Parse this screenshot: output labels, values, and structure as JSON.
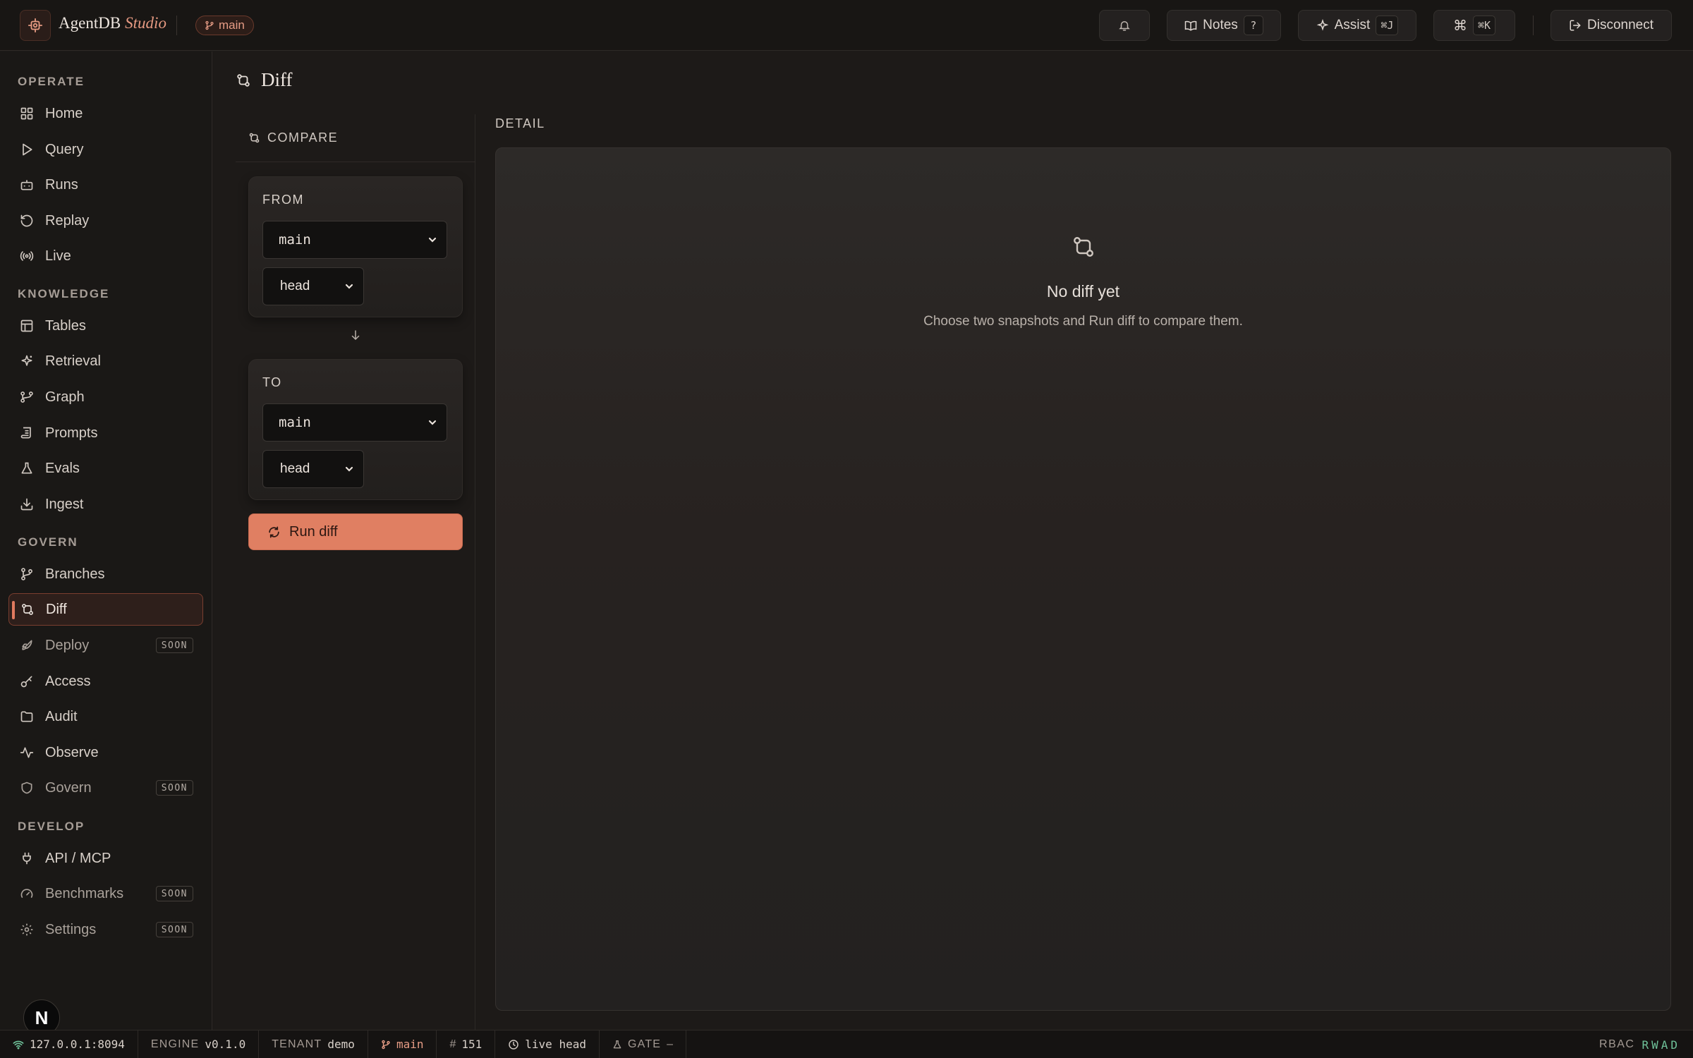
{
  "app": {
    "brand": "AgentDB",
    "brand_suffix": "Studio",
    "branch_badge": "main"
  },
  "topbar": {
    "notes_label": "Notes",
    "notes_kbd": "?",
    "assist_label": "Assist",
    "assist_kbd": "⌘J",
    "palette_symbol": "⌘",
    "palette_kbd": "⌘K",
    "disconnect_label": "Disconnect"
  },
  "sidebar": {
    "sections": [
      {
        "title": "OPERATE"
      },
      {
        "title": "KNOWLEDGE"
      },
      {
        "title": "GOVERN"
      },
      {
        "title": "DEVELOP"
      }
    ],
    "items": [
      {
        "label": "Home",
        "icon": "grid-icon"
      },
      {
        "label": "Query",
        "icon": "play-icon"
      },
      {
        "label": "Runs",
        "icon": "bot-icon"
      },
      {
        "label": "Replay",
        "icon": "rotate-ccw-icon"
      },
      {
        "label": "Live",
        "icon": "radio-icon"
      },
      {
        "label": "Tables",
        "icon": "table-icon"
      },
      {
        "label": "Retrieval",
        "icon": "sparkle-icon"
      },
      {
        "label": "Graph",
        "icon": "git-graph-icon"
      },
      {
        "label": "Prompts",
        "icon": "scroll-icon"
      },
      {
        "label": "Evals",
        "icon": "flask-icon"
      },
      {
        "label": "Ingest",
        "icon": "download-icon"
      },
      {
        "label": "Branches",
        "icon": "git-branch-icon"
      },
      {
        "label": "Diff",
        "icon": "git-compare-icon",
        "active": true
      },
      {
        "label": "Deploy",
        "icon": "rocket-icon",
        "badge": "SOON"
      },
      {
        "label": "Access",
        "icon": "key-icon"
      },
      {
        "label": "Audit",
        "icon": "folder-icon"
      },
      {
        "label": "Observe",
        "icon": "activity-icon"
      },
      {
        "label": "Govern",
        "icon": "shield-icon",
        "badge": "SOON"
      },
      {
        "label": "API / MCP",
        "icon": "plug-icon"
      },
      {
        "label": "Benchmarks",
        "icon": "gauge-icon",
        "badge": "SOON"
      },
      {
        "label": "Settings",
        "icon": "gear-icon",
        "badge": "SOON"
      }
    ],
    "avatar_letter": "N"
  },
  "main": {
    "page_title": "Diff",
    "compare": {
      "heading": "COMPARE",
      "from": {
        "label": "FROM",
        "branch": "main",
        "revision": "head"
      },
      "to": {
        "label": "TO",
        "branch": "main",
        "revision": "head"
      },
      "run_label": "Run diff"
    },
    "detail": {
      "heading": "DETAIL",
      "empty_title": "No diff yet",
      "empty_subtitle": "Choose two snapshots and Run diff to compare them."
    }
  },
  "statusbar": {
    "host": "127.0.0.1:8094",
    "engine_label": "ENGINE",
    "engine_version": "v0.1.0",
    "tenant_label": "TENANT",
    "tenant": "demo",
    "branch": "main",
    "commit": "151",
    "head": "live head",
    "gate_label": "GATE",
    "gate_value": "–",
    "rbac_label": "RBAC",
    "rbac_perms": "RWAD"
  },
  "colors": {
    "accent": "#e07f62",
    "background": "#1d1a18",
    "success": "#6fc29a"
  }
}
